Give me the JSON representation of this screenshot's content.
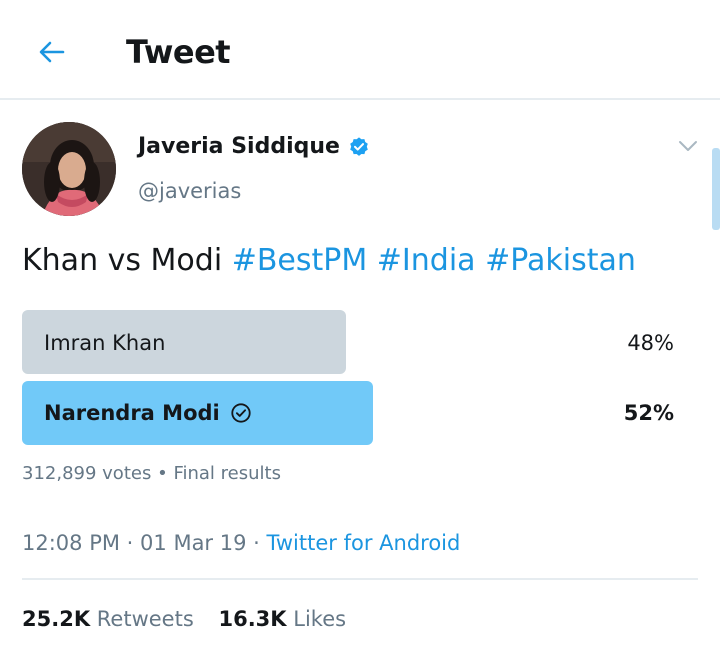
{
  "header": {
    "title": "Tweet",
    "back_icon": "arrow-left-icon"
  },
  "user": {
    "display_name": "Javeria Siddique",
    "handle": "@javerias",
    "verified": true
  },
  "tweet": {
    "text_plain": "Khan vs Modi",
    "hashtags": [
      "#BestPM",
      "#India",
      "#Pakistan"
    ]
  },
  "poll": {
    "options": [
      {
        "label": "Imran Khan",
        "percent": "48%",
        "fraction": 0.48,
        "winner": false
      },
      {
        "label": "Narendra Modi",
        "percent": "52%",
        "fraction": 0.52,
        "winner": true
      }
    ],
    "votes": "312,899 votes",
    "separator": "•",
    "status": "Final results"
  },
  "meta": {
    "time": "12:08 PM",
    "date": "01 Mar 19",
    "separator": "·",
    "source": "Twitter for Android"
  },
  "stats": {
    "retweets_count": "25.2K",
    "retweets_label": "Retweets",
    "likes_count": "16.3K",
    "likes_label": "Likes"
  },
  "colors": {
    "accent": "#1b95e0",
    "winner_bar": "#71c9f8",
    "loser_bar": "#ccd6dd",
    "muted": "#657786"
  }
}
